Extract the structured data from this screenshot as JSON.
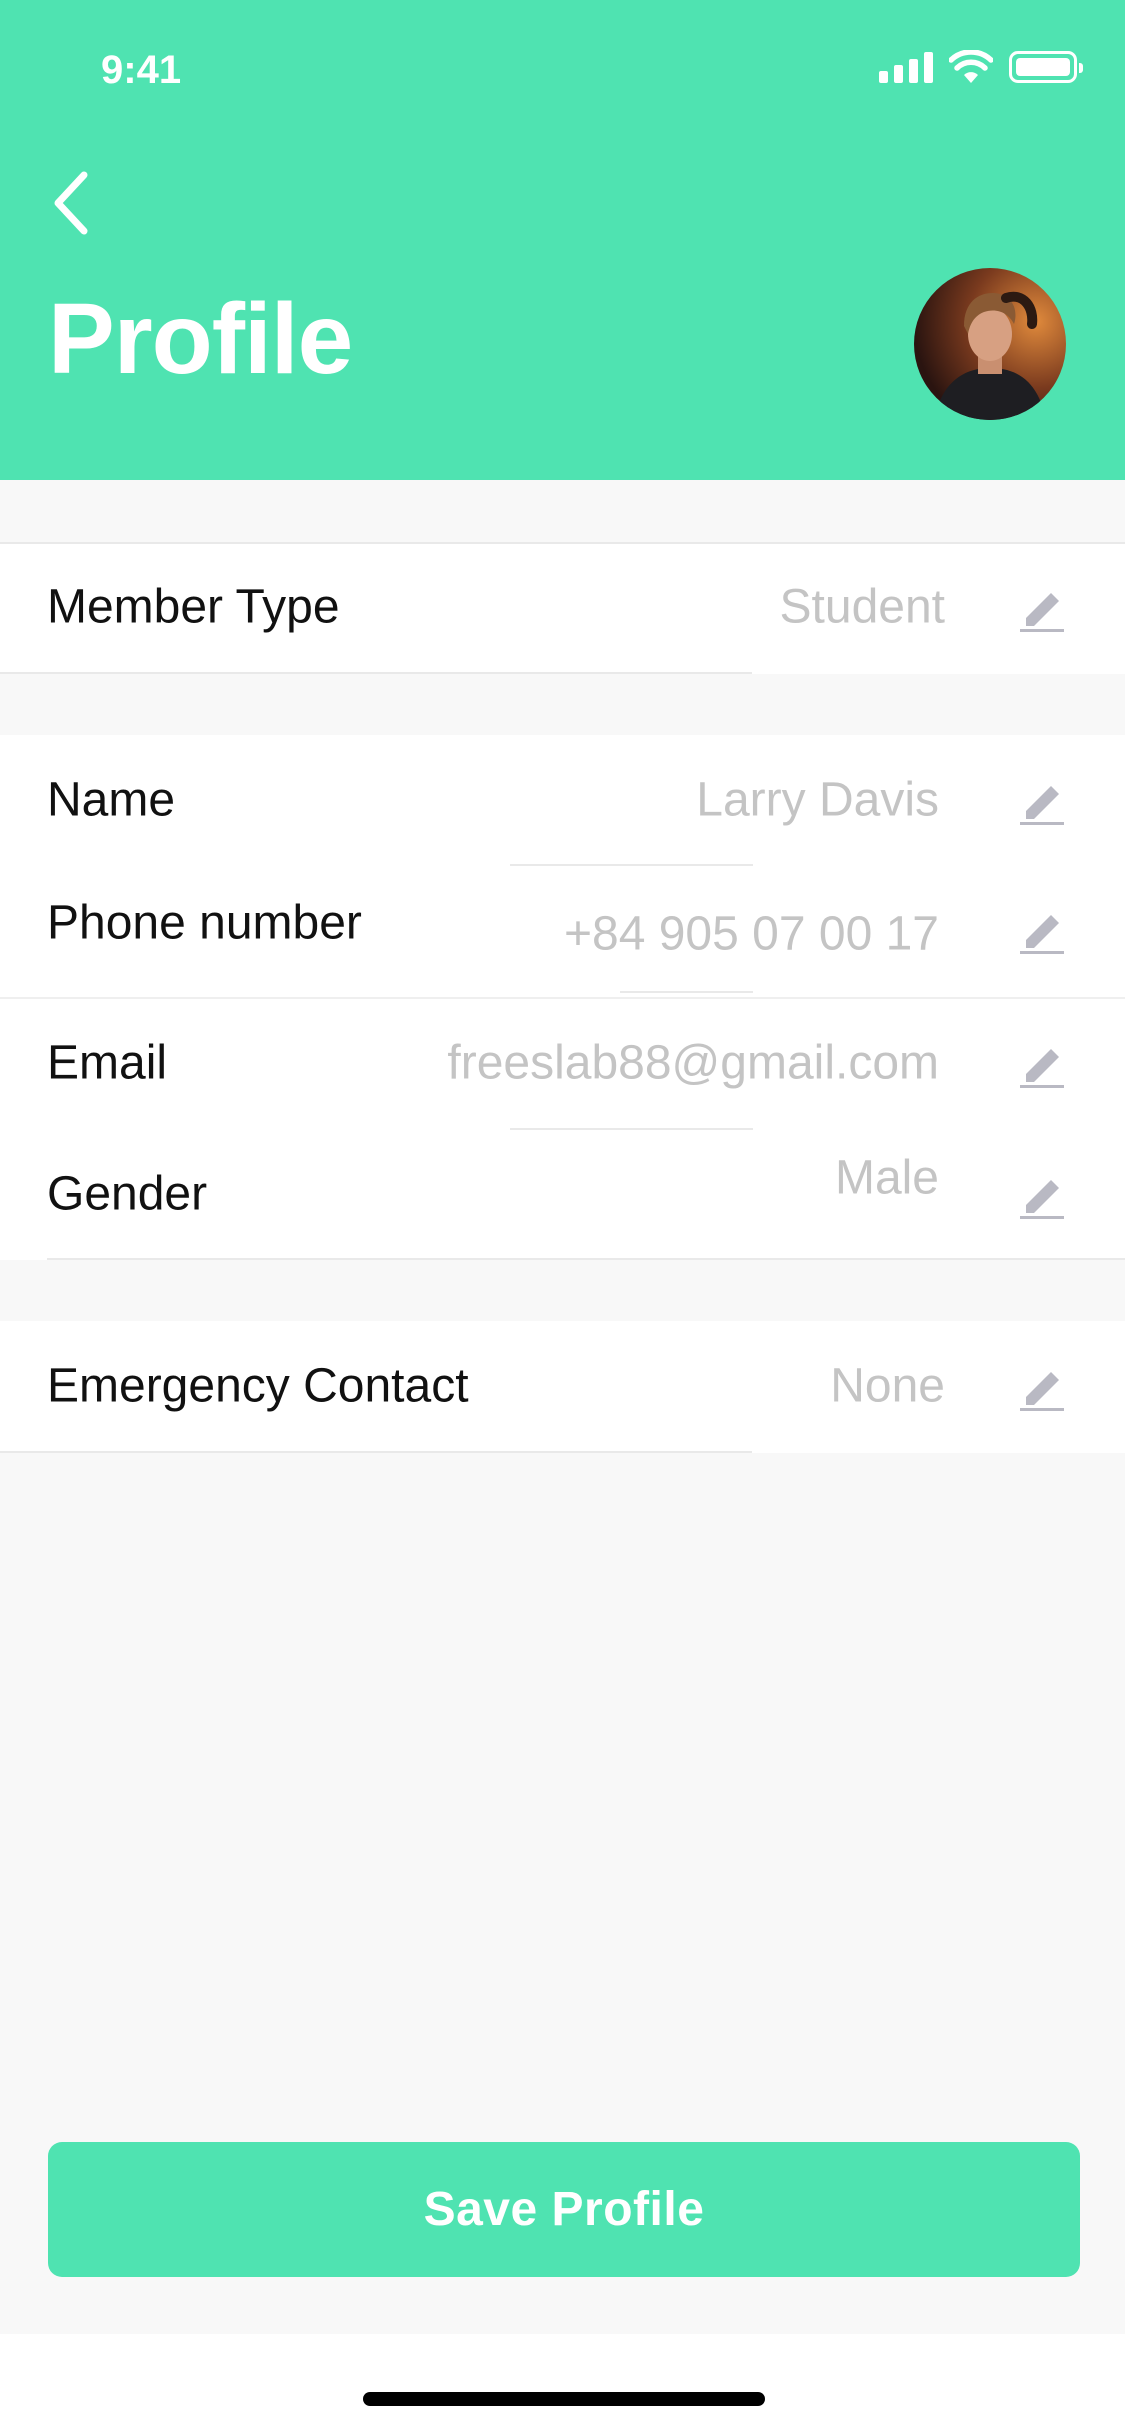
{
  "status_bar": {
    "time": "9:41"
  },
  "header": {
    "title": "Profile"
  },
  "sections": {
    "member_type": {
      "label": "Member Type",
      "value": "Student"
    },
    "name": {
      "label": "Name",
      "value": "Larry Davis"
    },
    "phone": {
      "label": "Phone number",
      "value": "+84 905 07 00 17"
    },
    "email": {
      "label": "Email",
      "value": "freeslab88@gmail.com"
    },
    "gender": {
      "label": "Gender",
      "value": "Male"
    },
    "emergency_contact": {
      "label": "Emergency Contact",
      "value": "None"
    }
  },
  "actions": {
    "save_label": "Save Profile"
  },
  "icons": {
    "back": "chevron-left-icon",
    "edit": "pencil-icon",
    "signal": "cellular-signal-icon",
    "wifi": "wifi-icon",
    "battery": "battery-icon"
  },
  "colors": {
    "accent": "#4FE3B1",
    "background": "#F8F8F8",
    "label_text": "#111111",
    "value_text": "#C4C4C4",
    "icon_gray": "#B9B9C3"
  }
}
